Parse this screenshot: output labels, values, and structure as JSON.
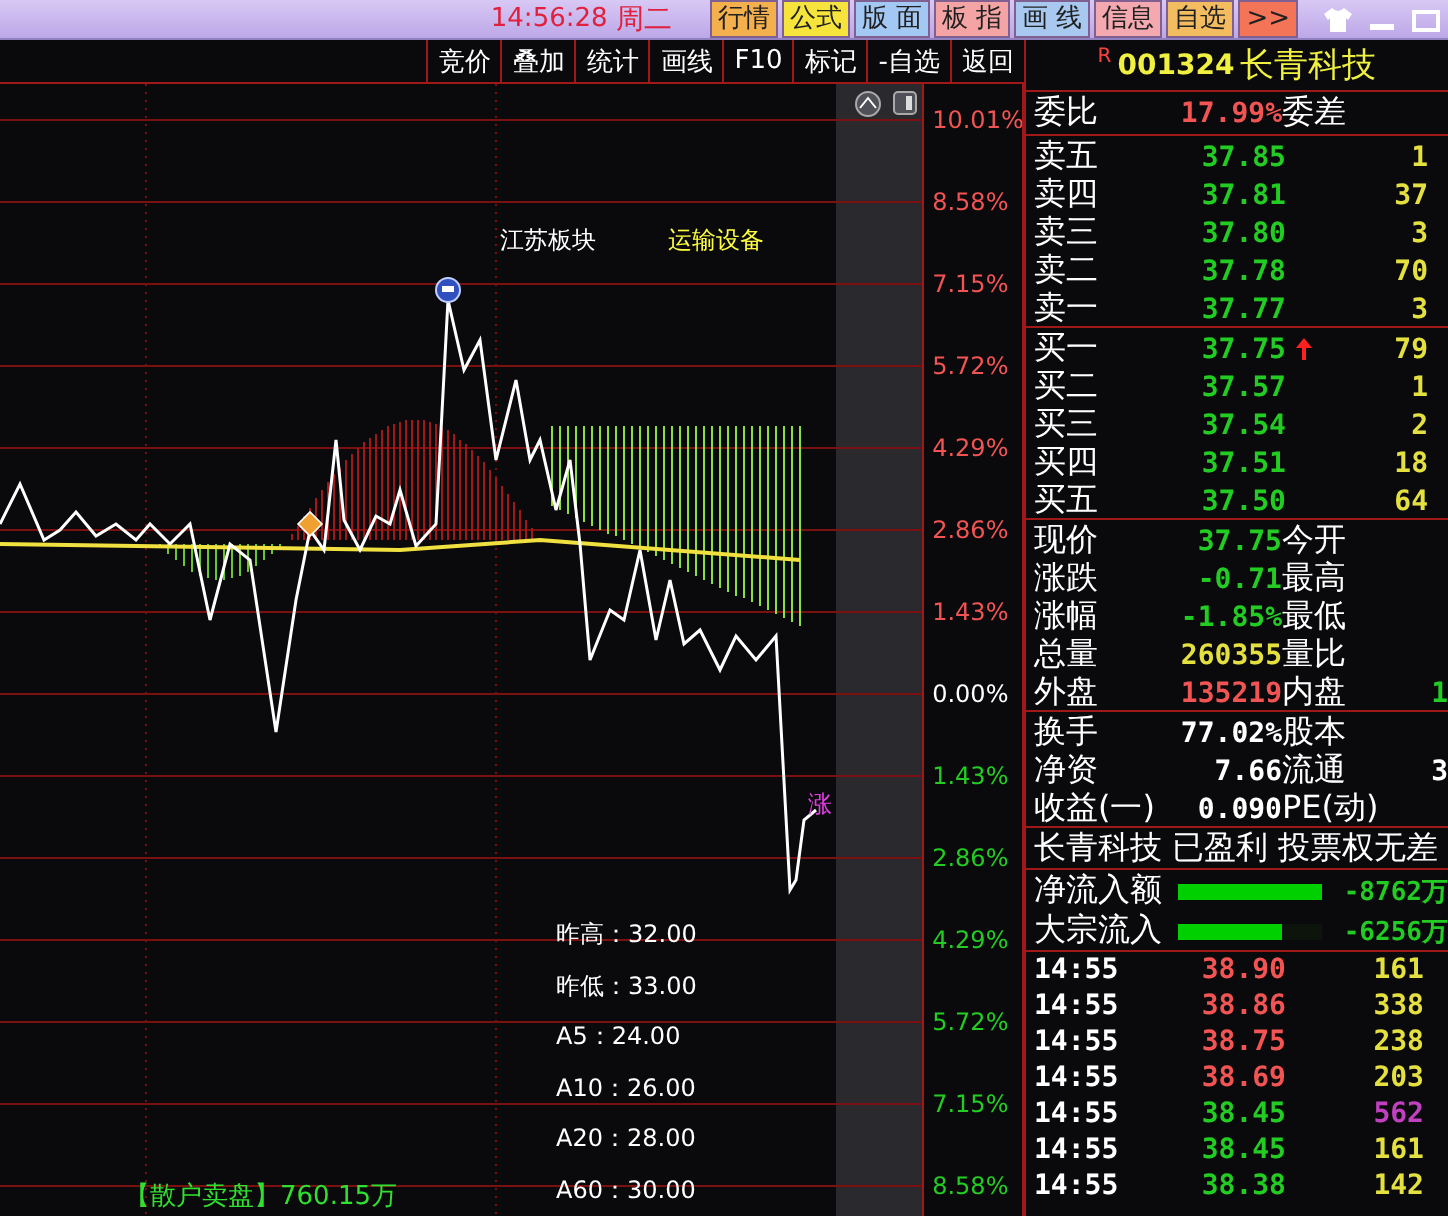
{
  "top_bar": {
    "clock": "14:56:28",
    "weekday": "周二",
    "buttons": [
      {
        "label": "行情",
        "color": "#f4b04c"
      },
      {
        "label": "公式",
        "color": "#f6e43c"
      },
      {
        "label": "版 面",
        "color": "#a4c8f4"
      },
      {
        "label": "板 指",
        "color": "#f4a4a4"
      },
      {
        "label": "画 线",
        "color": "#a8c8f0"
      },
      {
        "label": "信息",
        "color": "#f4a8b0"
      },
      {
        "label": "自选",
        "color": "#f4bc60"
      },
      {
        "label": ">>",
        "color": "#f47458"
      }
    ]
  },
  "toolbar": [
    "竞价",
    "叠加",
    "统计",
    "画线",
    "F10",
    "标记",
    "-自选",
    "返回"
  ],
  "chart": {
    "overlay_labels": [
      {
        "text": "江苏板块",
        "color": "#ffffff"
      },
      {
        "text": "运输设备",
        "color": "#ffff40"
      }
    ],
    "axis_labels": [
      {
        "text": "10.01%",
        "color": "#f25454"
      },
      {
        "text": "8.58%",
        "color": "#f25454"
      },
      {
        "text": "7.15%",
        "color": "#f25454"
      },
      {
        "text": "5.72%",
        "color": "#f25454"
      },
      {
        "text": "4.29%",
        "color": "#f25454"
      },
      {
        "text": "2.86%",
        "color": "#f25454"
      },
      {
        "text": "1.43%",
        "color": "#f25454"
      },
      {
        "text": "0.00%",
        "color": "#ffffff"
      },
      {
        "text": "1.43%",
        "color": "#22cc22"
      },
      {
        "text": "2.86%",
        "color": "#22cc22"
      },
      {
        "text": "4.29%",
        "color": "#22cc22"
      },
      {
        "text": "5.72%",
        "color": "#22cc22"
      },
      {
        "text": "7.15%",
        "color": "#22cc22"
      },
      {
        "text": "8.58%",
        "color": "#22cc22"
      }
    ],
    "rise_mark": "涨",
    "stats": [
      "昨高：32.00",
      "昨低：33.00",
      "A5：24.00",
      "A10：26.00",
      "A20：28.00",
      "A60：30.00"
    ],
    "retail_sell": {
      "label": "【散户卖盘】",
      "value": "760.15万"
    }
  },
  "stock": {
    "flag": "R",
    "code": "001324",
    "name": "长青科技"
  },
  "order_ratio": {
    "label": "委比",
    "value": "17.99%",
    "label_2": "委差"
  },
  "asks": [
    {
      "label": "卖五",
      "price": "37.85",
      "volume": "1"
    },
    {
      "label": "卖四",
      "price": "37.81",
      "volume": "37"
    },
    {
      "label": "卖三",
      "price": "37.80",
      "volume": "3"
    },
    {
      "label": "卖二",
      "price": "37.78",
      "volume": "70"
    },
    {
      "label": "卖一",
      "price": "37.77",
      "volume": "3"
    }
  ],
  "bids": [
    {
      "label": "买一",
      "price": "37.75",
      "volume": "79",
      "up_arrow": true
    },
    {
      "label": "买二",
      "price": "37.57",
      "volume": "1",
      "up_arrow": false
    },
    {
      "label": "买三",
      "price": "37.54",
      "volume": "2",
      "up_arrow": false
    },
    {
      "label": "买四",
      "price": "37.51",
      "volume": "18",
      "up_arrow": false
    },
    {
      "label": "买五",
      "price": "37.50",
      "volume": "64",
      "up_arrow": false
    }
  ],
  "quotes": [
    {
      "label": "现价",
      "value": "37.75",
      "color": "#22cc22",
      "label_2": "今开"
    },
    {
      "label": "涨跌",
      "value": "-0.71",
      "color": "#22cc22",
      "label_2": "最高"
    },
    {
      "label": "涨幅",
      "value": "-1.85%",
      "color": "#22cc22",
      "label_2": "最低"
    },
    {
      "label": "总量",
      "value": "260355",
      "color": "#e4e040",
      "label_2": "量比"
    },
    {
      "label": "外盘",
      "value": "135219",
      "color": "#f25454",
      "label_2": "内盘",
      "value_2": "1"
    }
  ],
  "fundamentals": [
    {
      "label": "换手",
      "value": "77.02%",
      "label_2": "股本"
    },
    {
      "label": "净资",
      "value": "7.66",
      "label_2": "流通",
      "value_2": "3"
    },
    {
      "label": "收益(一)",
      "value": "0.090",
      "label_2": "PE(动)"
    }
  ],
  "tags": "长青科技 已盈利 投票权无差",
  "flows": [
    {
      "label": "净流入额",
      "level": 1,
      "value": "-8762万"
    },
    {
      "label": "大宗流入",
      "level": 0.72,
      "value": "-6256万"
    }
  ],
  "ticks": [
    {
      "time": "14:55",
      "price": "38.90",
      "color": "#f25454",
      "volume": "161",
      "large": false
    },
    {
      "time": "14:55",
      "price": "38.86",
      "color": "#f25454",
      "volume": "338",
      "large": false
    },
    {
      "time": "14:55",
      "price": "38.75",
      "color": "#f25454",
      "volume": "238",
      "large": false
    },
    {
      "time": "14:55",
      "price": "38.69",
      "color": "#f25454",
      "volume": "203",
      "large": false
    },
    {
      "time": "14:55",
      "price": "38.45",
      "color": "#22cc22",
      "volume": "562",
      "large": true
    },
    {
      "time": "14:55",
      "price": "38.45",
      "color": "#22cc22",
      "volume": "161",
      "large": false
    },
    {
      "time": "14:55",
      "price": "38.38",
      "color": "#22cc22",
      "volume": "142",
      "large": false
    }
  ]
}
